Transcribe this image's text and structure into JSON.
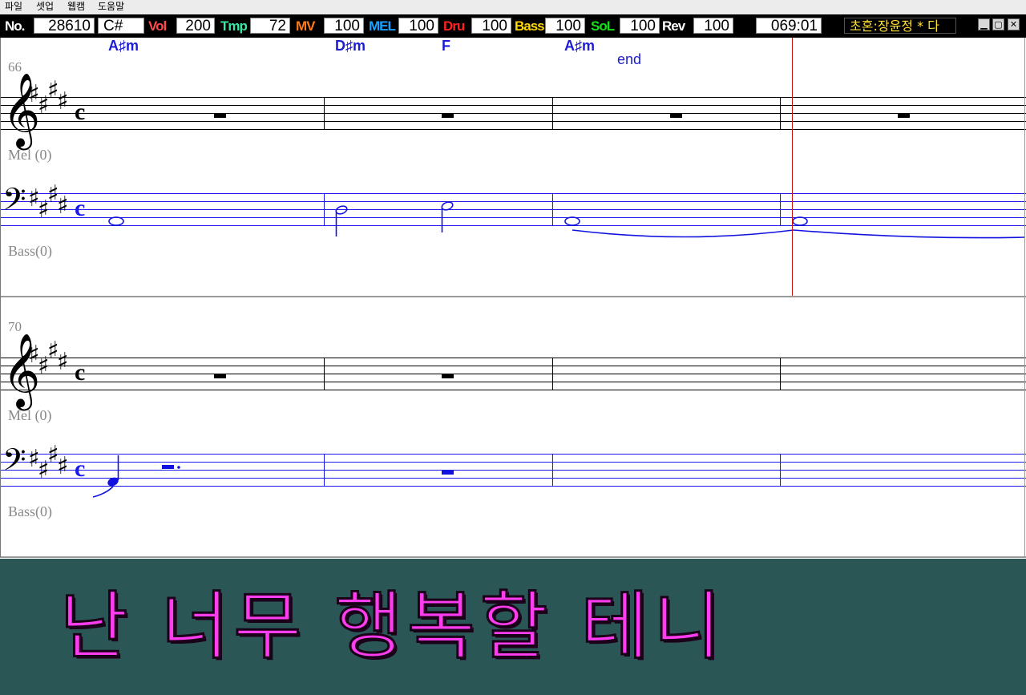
{
  "menu": {
    "items": [
      "파일",
      "셋업",
      "웹캠",
      "도움말"
    ]
  },
  "toolbar": {
    "no_label": "No.",
    "no_value": "28610",
    "key_value": "C#",
    "vol_label": "Vol",
    "vol_value": "200",
    "temp_label": "Tmp",
    "temp_value": "72",
    "mv_label": "MV",
    "mv_value": "100",
    "mel_label": "MEL",
    "mel_value": "100",
    "dru_label": "Dru",
    "dru_value": "100",
    "bass_label": "Bass",
    "bass_value": "100",
    "sol_label": "SoL",
    "sol_value": "100",
    "rev_label": "Rev",
    "rev_value": "100",
    "time_value": "069:01",
    "song_title": "초혼:장윤정 * 다",
    "colors": {
      "vol": "#ff4a4a",
      "temp": "#38e8a0",
      "mv": "#ff7a18",
      "mel": "#1aa0ff",
      "dru": "#ff2020",
      "bass": "#ffd700",
      "sol": "#18e018",
      "rev": "#ffffff",
      "no": "#ffffff"
    }
  },
  "score": {
    "systems": [
      {
        "measure_number": "66",
        "chords": [
          "A♯m",
          "D♯m",
          "F",
          "A♯m"
        ],
        "end_marker": "end",
        "mel_label": "Mel (0)",
        "bass_label": "Bass(0)"
      },
      {
        "measure_number": "70",
        "mel_label": "Mel (0)",
        "bass_label": "Bass(0)"
      }
    ],
    "clef_treble": "𝄞",
    "clef_bass": "𝄢",
    "sharp": "♯",
    "time_signature": "c",
    "colors": {
      "notes": "#1212e0",
      "playhead": "#cc1111",
      "staff_black": "#000000",
      "staff_blue": "#1a1aee"
    }
  },
  "lyrics": {
    "line": "난 너무 행복할 테니",
    "color": "#ff3df0",
    "background": "#2a5656"
  }
}
